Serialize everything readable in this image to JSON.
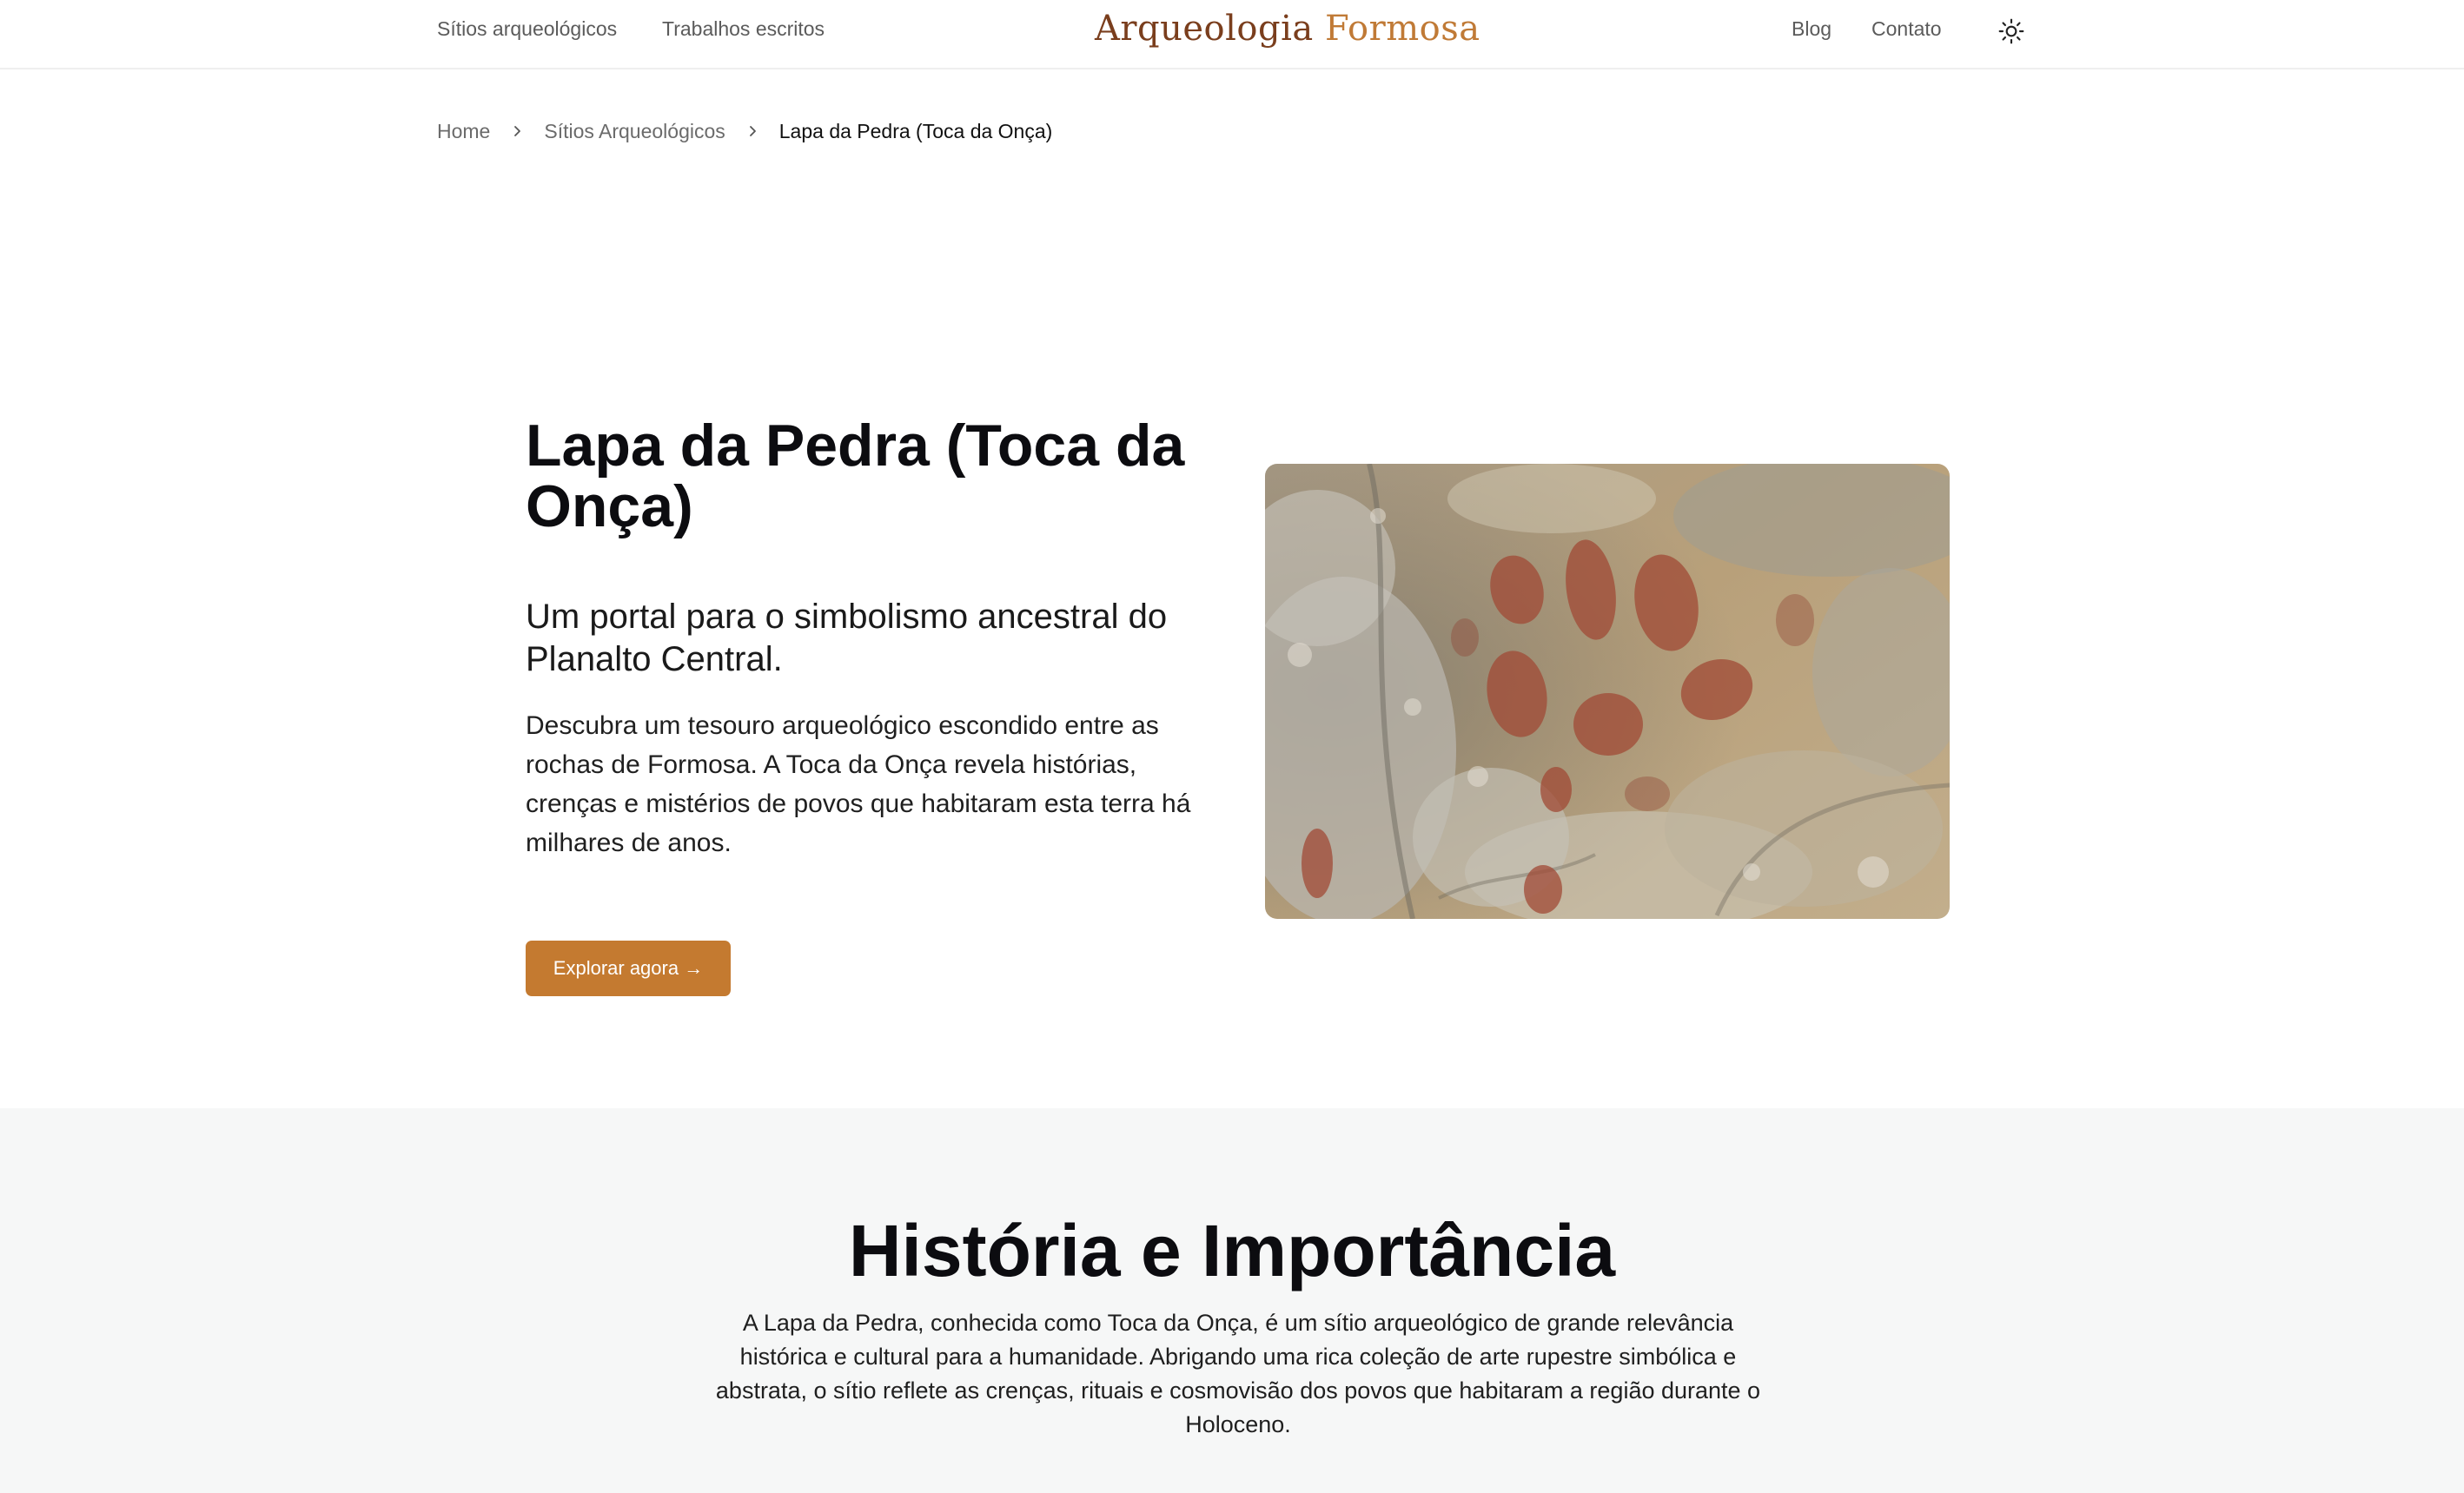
{
  "header": {
    "nav_left": [
      "Sítios arqueológicos",
      "Trabalhos escritos"
    ],
    "logo": {
      "part1": "Arqueologia",
      "part2": "Formosa"
    },
    "nav_right": [
      "Blog",
      "Contato"
    ],
    "theme_icon": "sun-icon"
  },
  "breadcrumb": {
    "items": [
      "Home",
      "Sítios Arqueológicos"
    ],
    "current": "Lapa da Pedra (Toca da Onça)",
    "separator_icon": "chevron-right-icon"
  },
  "hero": {
    "title": "Lapa da Pedra (Toca da Onça)",
    "subtitle": "Um portal para o simbolismo ancestral do Planalto Central.",
    "description": "Descubra um tesouro arqueológico escondido entre as rochas de Formosa. A Toca da Onça revela histórias, crenças e mistérios de povos que habitaram esta terra há milhares de anos.",
    "cta_label": "Explorar agora →"
  },
  "history": {
    "heading": "História e Importância",
    "text": "A Lapa da Pedra, conhecida como Toca da Onça, é um sítio arqueológico de grande relevância histórica e cultural para a humanidade. Abrigando uma rica coleção de arte rupestre simbólica e abstrata, o sítio reflete as crenças, rituais e cosmovisão dos povos que habitaram a região durante o Holoceno."
  },
  "colors": {
    "accent": "#c47a30",
    "logo_dark": "#7a3e1d",
    "logo_light": "#c07a36",
    "section_bg": "#f6f7f7"
  }
}
